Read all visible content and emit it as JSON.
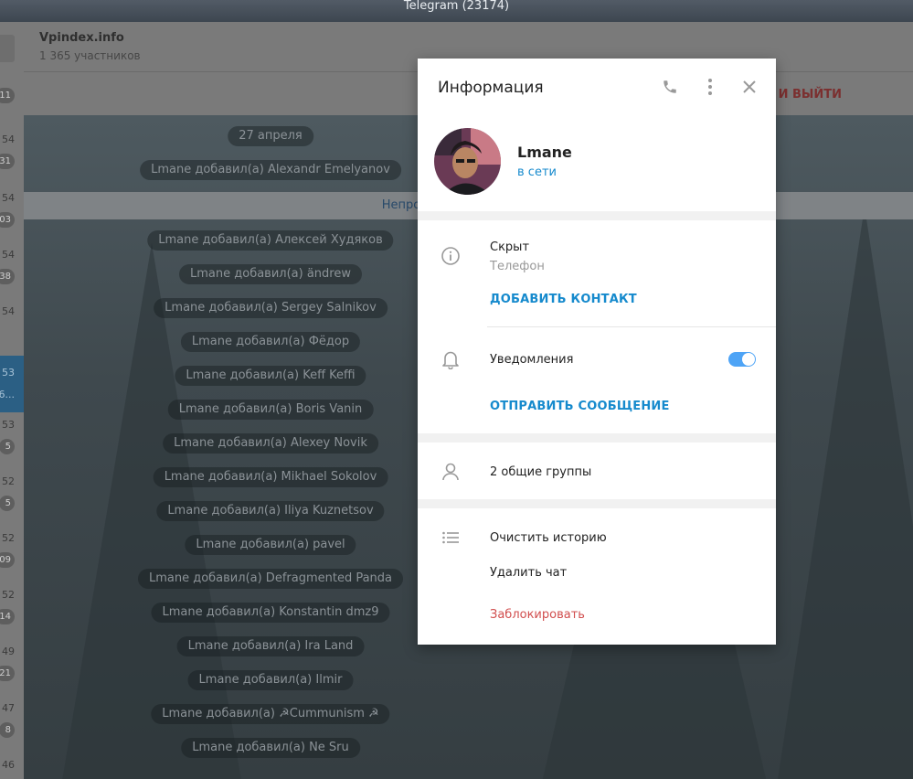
{
  "window": {
    "title": "Telegram (23174)"
  },
  "chat_list": {
    "rows": [
      {
        "time": "",
        "badge": "11"
      },
      {
        "time": "54",
        "badge": "31"
      },
      {
        "time": "54",
        "badge": "03"
      },
      {
        "time": "54",
        "badge": "38"
      },
      {
        "time": "54",
        "badge": ""
      },
      {
        "time": "53",
        "badge": "",
        "snippet": "6..."
      },
      {
        "time": "53",
        "badge": "5"
      },
      {
        "time": "52",
        "badge": "5"
      },
      {
        "time": "52",
        "badge": "09"
      },
      {
        "time": "52",
        "badge": "14"
      },
      {
        "time": "49",
        "badge": "21"
      },
      {
        "time": "47",
        "badge": "8"
      },
      {
        "time": "46",
        "badge": ""
      }
    ]
  },
  "chat": {
    "name": "Vpindex.info",
    "members": "1 365 участников",
    "leave_button": "Е И ВЫЙТИ",
    "date_label": "27 апреля",
    "first_service": "Lmane добавил(а) Alexandr Emelyanov",
    "unread_label": "Непрочитанные сообщения",
    "service_messages": [
      "Lmane добавил(а) Алексей Худяков",
      "Lmane добавил(а) ändrew",
      "Lmane добавил(а) Sergey Salnikov",
      "Lmane добавил(а) Фёдор",
      "Lmane добавил(а) Keff Keffi",
      "Lmane добавил(а) Boris Vanin",
      "Lmane добавил(а) Alexey Novik",
      "Lmane добавил(а) Mikhael Sokolov",
      "Lmane добавил(а) Iliya Kuznetsov",
      "Lmane добавил(а) pavel",
      "Lmane добавил(а) Defragmented Panda",
      "Lmane добавил(а) Konstantin dmz9",
      "Lmane добавил(а) Ira Land",
      "Lmane добавил(а) Ilmir",
      "Lmane добавил(а) ☭Cummunism ☭",
      "Lmane добавил(а) Ne Sru"
    ]
  },
  "info_modal": {
    "title": "Информация",
    "icons": {
      "call": "phone-icon",
      "menu": "more-vertical-icon",
      "close": "close-icon"
    },
    "user": {
      "name": "Lmane",
      "status": "в сети"
    },
    "phone": {
      "value": "Скрыт",
      "label": "Телефон",
      "add_contact": "ДОБАВИТЬ КОНТАКТ"
    },
    "notifications": {
      "label": "Уведомления",
      "enabled": true,
      "send_message": "ОТПРАВИТЬ СООБЩЕНИЕ"
    },
    "common_groups": "2 общие группы",
    "actions": {
      "clear_history": "Очистить историю",
      "delete_chat": "Удалить чат",
      "block": "Заблокировать"
    },
    "colors": {
      "accent": "#168acd",
      "danger": "#d14e4e",
      "toggle": "#4ea4f6"
    }
  }
}
